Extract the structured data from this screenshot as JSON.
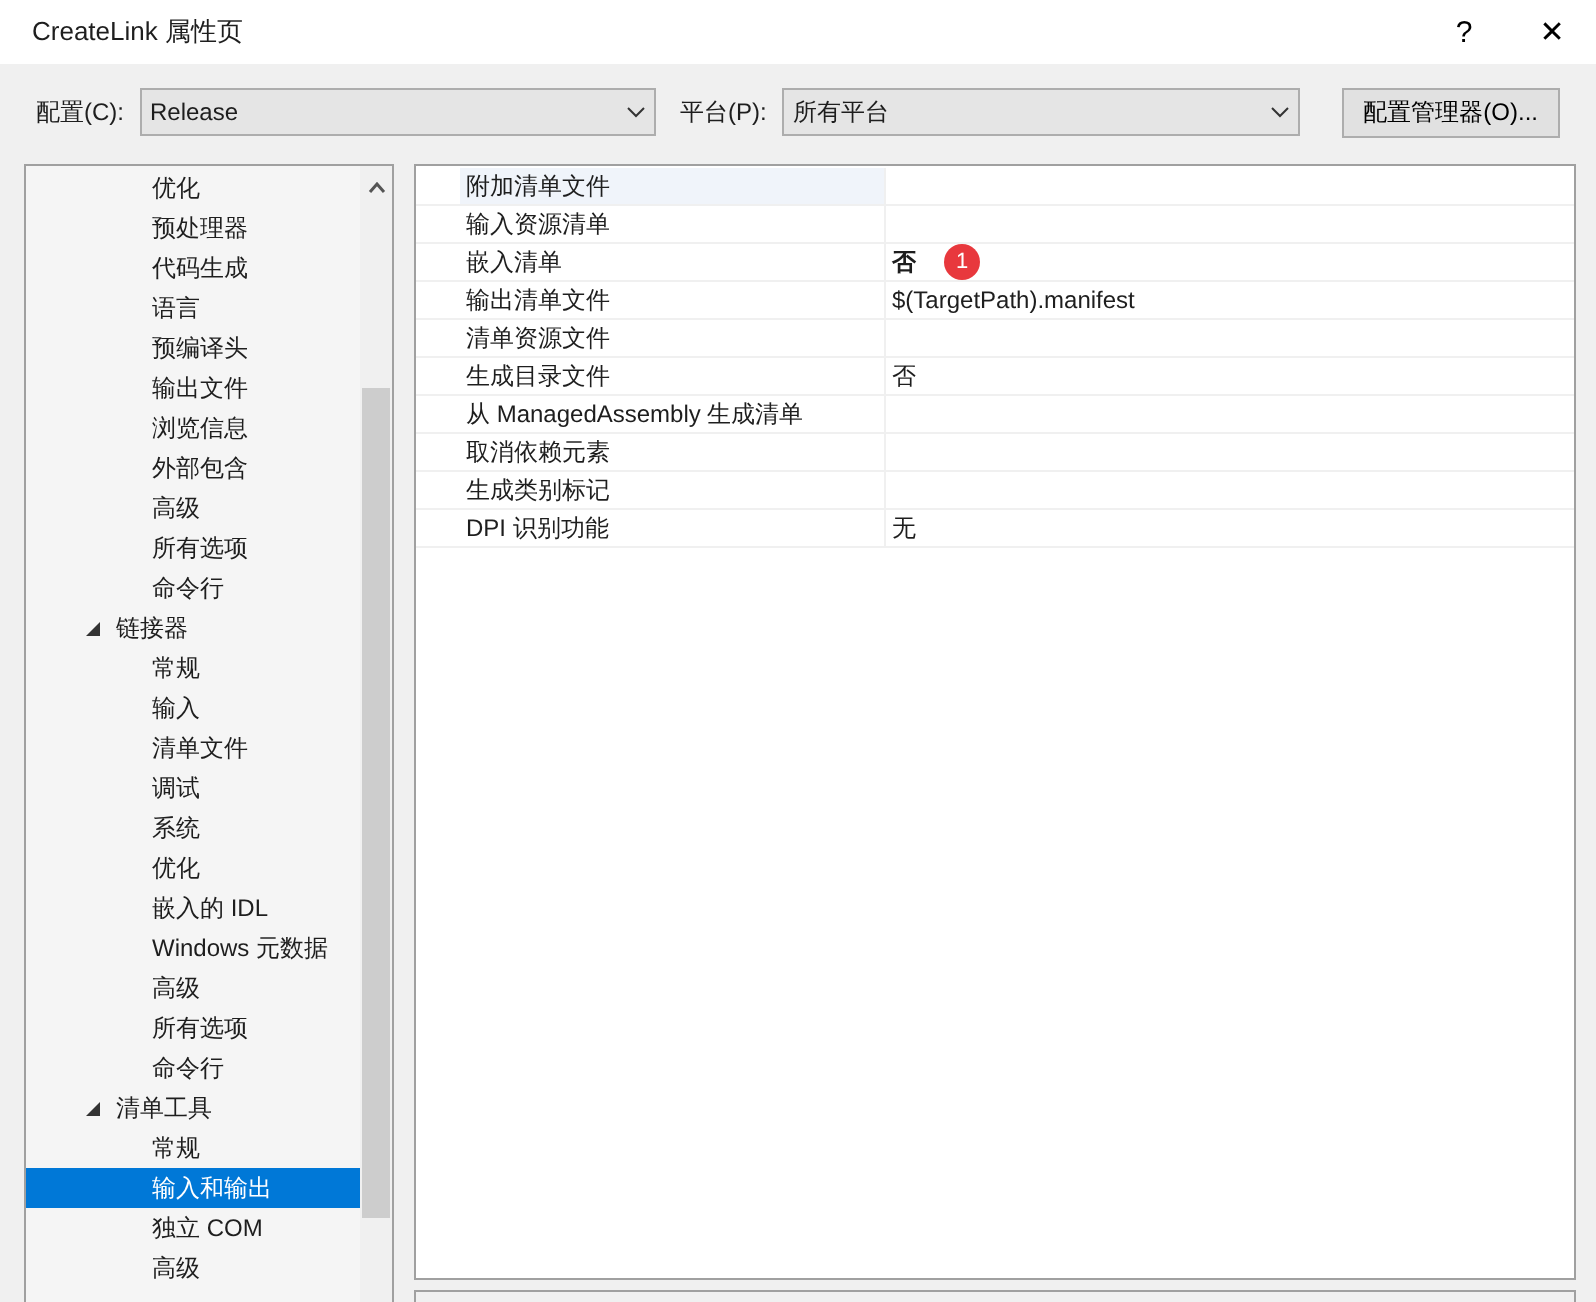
{
  "window": {
    "title": "CreateLink 属性页",
    "help": "?",
    "close": "✕"
  },
  "toolbar": {
    "config_label": "配置(C):",
    "config_value": "Release",
    "platform_label": "平台(P):",
    "platform_value": "所有平台",
    "manager_button": "配置管理器(O)..."
  },
  "tree": [
    {
      "children": [
        {
          "label": "优化",
          "selected": false
        },
        {
          "label": "预处理器",
          "selected": false
        },
        {
          "label": "代码生成",
          "selected": false
        },
        {
          "label": "语言",
          "selected": false
        },
        {
          "label": "预编译头",
          "selected": false
        },
        {
          "label": "输出文件",
          "selected": false
        },
        {
          "label": "浏览信息",
          "selected": false
        },
        {
          "label": "外部包含",
          "selected": false
        },
        {
          "label": "高级",
          "selected": false
        },
        {
          "label": "所有选项",
          "selected": false
        },
        {
          "label": "命令行",
          "selected": false
        }
      ]
    },
    {
      "label": "链接器",
      "selected": false,
      "expanded": true,
      "children": [
        {
          "label": "常规",
          "selected": false
        },
        {
          "label": "输入",
          "selected": false
        },
        {
          "label": "清单文件",
          "selected": false
        },
        {
          "label": "调试",
          "selected": false
        },
        {
          "label": "系统",
          "selected": false
        },
        {
          "label": "优化",
          "selected": false
        },
        {
          "label": "嵌入的 IDL",
          "selected": false
        },
        {
          "label": "Windows 元数据",
          "selected": false
        },
        {
          "label": "高级",
          "selected": false
        },
        {
          "label": "所有选项",
          "selected": false
        },
        {
          "label": "命令行",
          "selected": false
        }
      ]
    },
    {
      "label": "清单工具",
      "selected": false,
      "expanded": true,
      "children": [
        {
          "label": "常规",
          "selected": false
        },
        {
          "label": "输入和输出",
          "selected": true
        },
        {
          "label": "独立 COM",
          "selected": false
        },
        {
          "label": "高级",
          "selected": false
        }
      ]
    }
  ],
  "properties": [
    {
      "name": "附加清单文件",
      "selected": true
    },
    {
      "name": "输入资源清单",
      "selected": false
    },
    {
      "name": "嵌入清单",
      "value": "否",
      "bold": true,
      "selected": false,
      "badge": "1"
    },
    {
      "name": "输出清单文件",
      "value": "$(TargetPath).manifest",
      "bold": false,
      "selected": false
    },
    {
      "name": "清单资源文件",
      "selected": false
    },
    {
      "name": "生成目录文件",
      "value": "否",
      "bold": false,
      "selected": false
    },
    {
      "name": "从 ManagedAssembly 生成清单",
      "selected": false
    },
    {
      "name": "取消依赖元素",
      "selected": false
    },
    {
      "name": "生成类别标记",
      "selected": false
    },
    {
      "name": "DPI 识别功能",
      "value": "无",
      "bold": false,
      "selected": false
    }
  ]
}
